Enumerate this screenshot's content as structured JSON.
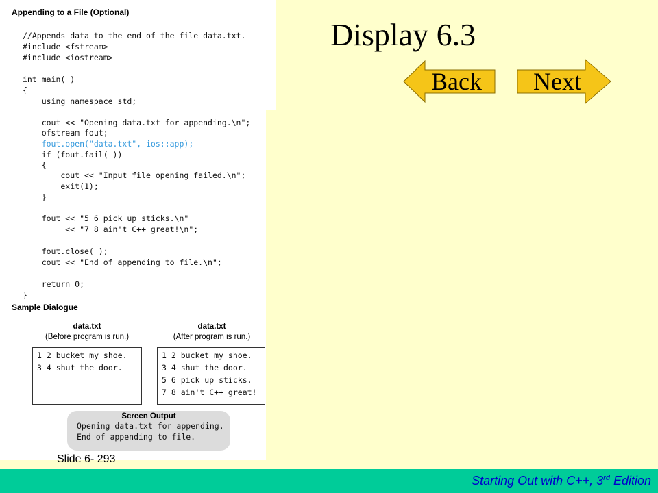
{
  "slide": {
    "title": "Display 6.3",
    "slide_number": "Slide 6- 293",
    "footer": {
      "book": "Starting Out with C++, 3",
      "sup": "rd",
      "edition": " Edition"
    },
    "nav": {
      "back_label": "Back",
      "next_label": "Next"
    },
    "colors": {
      "background": "#ffffcc",
      "footer_bar": "#00cc99",
      "footer_text": "#0000cc",
      "arrow_fill": "#f5c518"
    }
  },
  "figure": {
    "title": "Appending to a File (Optional)",
    "code_lines": [
      "//Appends data to the end of the file data.txt.",
      "#include <fstream>",
      "#include <iostream>",
      "",
      "int main( )",
      "{",
      "    using namespace std;",
      "",
      "    cout << \"Opening data.txt for appending.\\n\";",
      "    ofstream fout;",
      "    fout.open(\"data.txt\", ios::app);",
      "    if (fout.fail( ))",
      "    {",
      "        cout << \"Input file opening failed.\\n\";",
      "        exit(1);",
      "    }",
      "",
      "    fout << \"5 6 pick up sticks.\\n\"",
      "         << \"7 8 ain't C++ great!\\n\";",
      "",
      "    fout.close( );",
      "    cout << \"End of appending to file.\\n\";",
      "",
      "    return 0;",
      "}"
    ],
    "sample_heading": "Sample Dialogue",
    "before": {
      "name": "data.txt",
      "note": "(Before program is run.)",
      "lines": [
        "1 2 bucket my shoe.",
        "3 4 shut the door."
      ]
    },
    "after": {
      "name": "data.txt",
      "note": "(After program is run.)",
      "lines": [
        "1 2 bucket my shoe.",
        "3 4 shut the door.",
        "5 6 pick up sticks.",
        "7 8 ain't C++ great!"
      ]
    },
    "screen_output": {
      "title": "Screen Output",
      "lines": [
        "Opening data.txt for appending.",
        "End of appending to file."
      ]
    }
  }
}
